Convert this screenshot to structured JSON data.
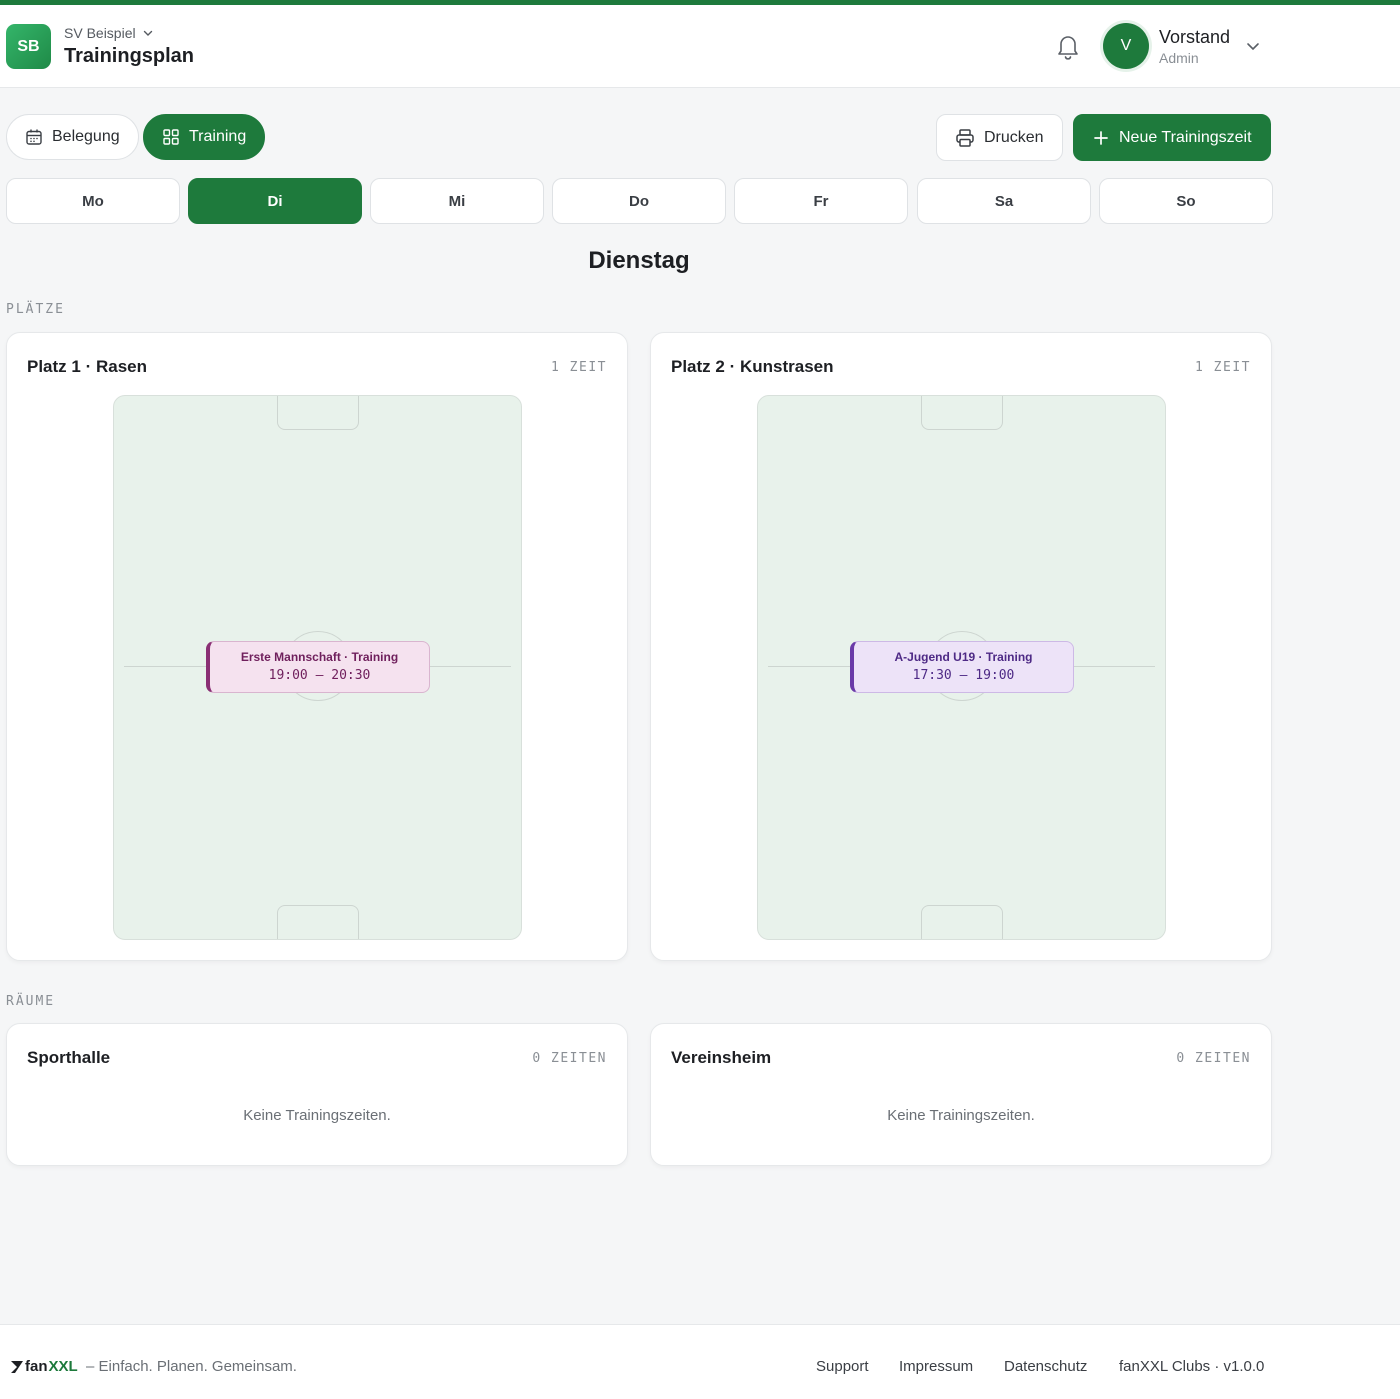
{
  "header": {
    "logo_initials": "SB",
    "club_name": "SV Beispiel",
    "title": "Trainingsplan",
    "user_initial": "V",
    "user_name": "Vorstand",
    "user_role": "Admin"
  },
  "toolbar": {
    "view_booking": "Belegung",
    "view_training": "Training",
    "print": "Drucken",
    "new_slot": "Neue Trainingszeit"
  },
  "days": [
    "Mo",
    "Di",
    "Mi",
    "Do",
    "Fr",
    "Sa",
    "So"
  ],
  "active_day": "Di",
  "day_heading": "Dienstag",
  "sections": {
    "fields_label": "PLÄTZE",
    "rooms_label": "RÄUME"
  },
  "fields": [
    {
      "name": "Platz 1 · Rasen",
      "count": "1 ZEIT",
      "slot_title": "Erste Mannschaft · Training",
      "slot_time": "19:00 – 20:30"
    },
    {
      "name": "Platz 2 · Kunstrasen",
      "count": "1 ZEIT",
      "slot_title": "A-Jugend U19 · Training",
      "slot_time": "17:30 – 19:00"
    }
  ],
  "rooms": [
    {
      "name": "Sporthalle",
      "count": "0 ZEITEN",
      "empty": "Keine Trainingszeiten."
    },
    {
      "name": "Vereinsheim",
      "count": "0 ZEITEN",
      "empty": "Keine Trainingszeiten."
    }
  ],
  "footer": {
    "brand_fan": "fan",
    "brand_xxl": "XXL",
    "tagline": "– Einfach. Planen. Gemeinsam.",
    "support": "Support",
    "imprint": "Impressum",
    "privacy": "Datenschutz",
    "version": "fanXXL Clubs · v1.0.0"
  },
  "colors": {
    "accent": "#1e7a3c",
    "slot_pink": "#f5e2ef",
    "slot_purple": "#ede3f8",
    "pitch": "#e8f2eb"
  },
  "icons": [
    "chevron-down-icon",
    "bell-icon",
    "calendar-icon",
    "grid-icon",
    "printer-icon",
    "plus-icon",
    "fanxxl-logo-icon"
  ]
}
